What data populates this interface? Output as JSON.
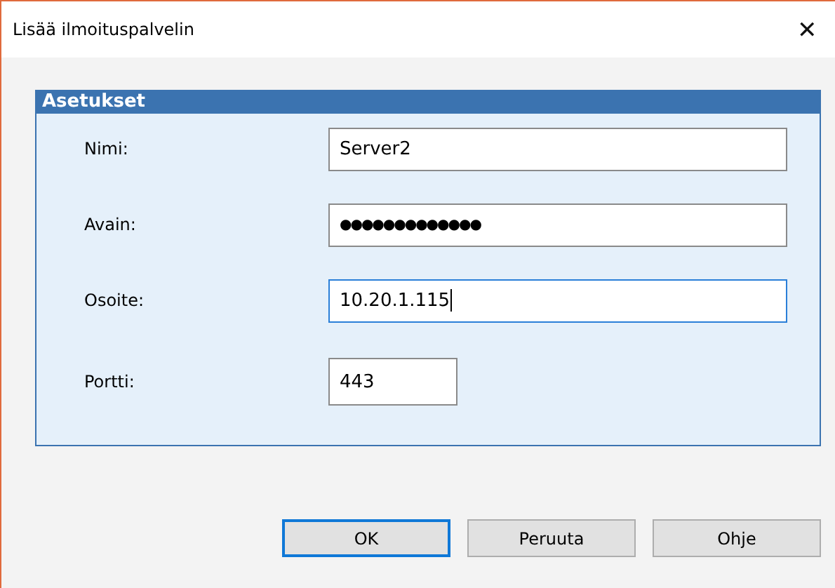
{
  "window": {
    "title": "Lisää ilmoituspalvelin",
    "close": "✕"
  },
  "group": {
    "title": "Asetukset",
    "fields": [
      {
        "label": "Nimi:",
        "value": "Server2",
        "focused": false,
        "kind": "text"
      },
      {
        "label": "Avain:",
        "value": "●●●●●●●●●●●●●",
        "focused": false,
        "kind": "password"
      },
      {
        "label": "Osoite:",
        "value": "10.20.1.115",
        "focused": true,
        "kind": "text"
      },
      {
        "label": "Portti:",
        "value": "443",
        "focused": false,
        "kind": "number"
      }
    ]
  },
  "buttons": [
    {
      "label": "OK",
      "focused": true
    },
    {
      "label": "Peruuta",
      "focused": false
    },
    {
      "label": "Ohje",
      "focused": false
    }
  ]
}
